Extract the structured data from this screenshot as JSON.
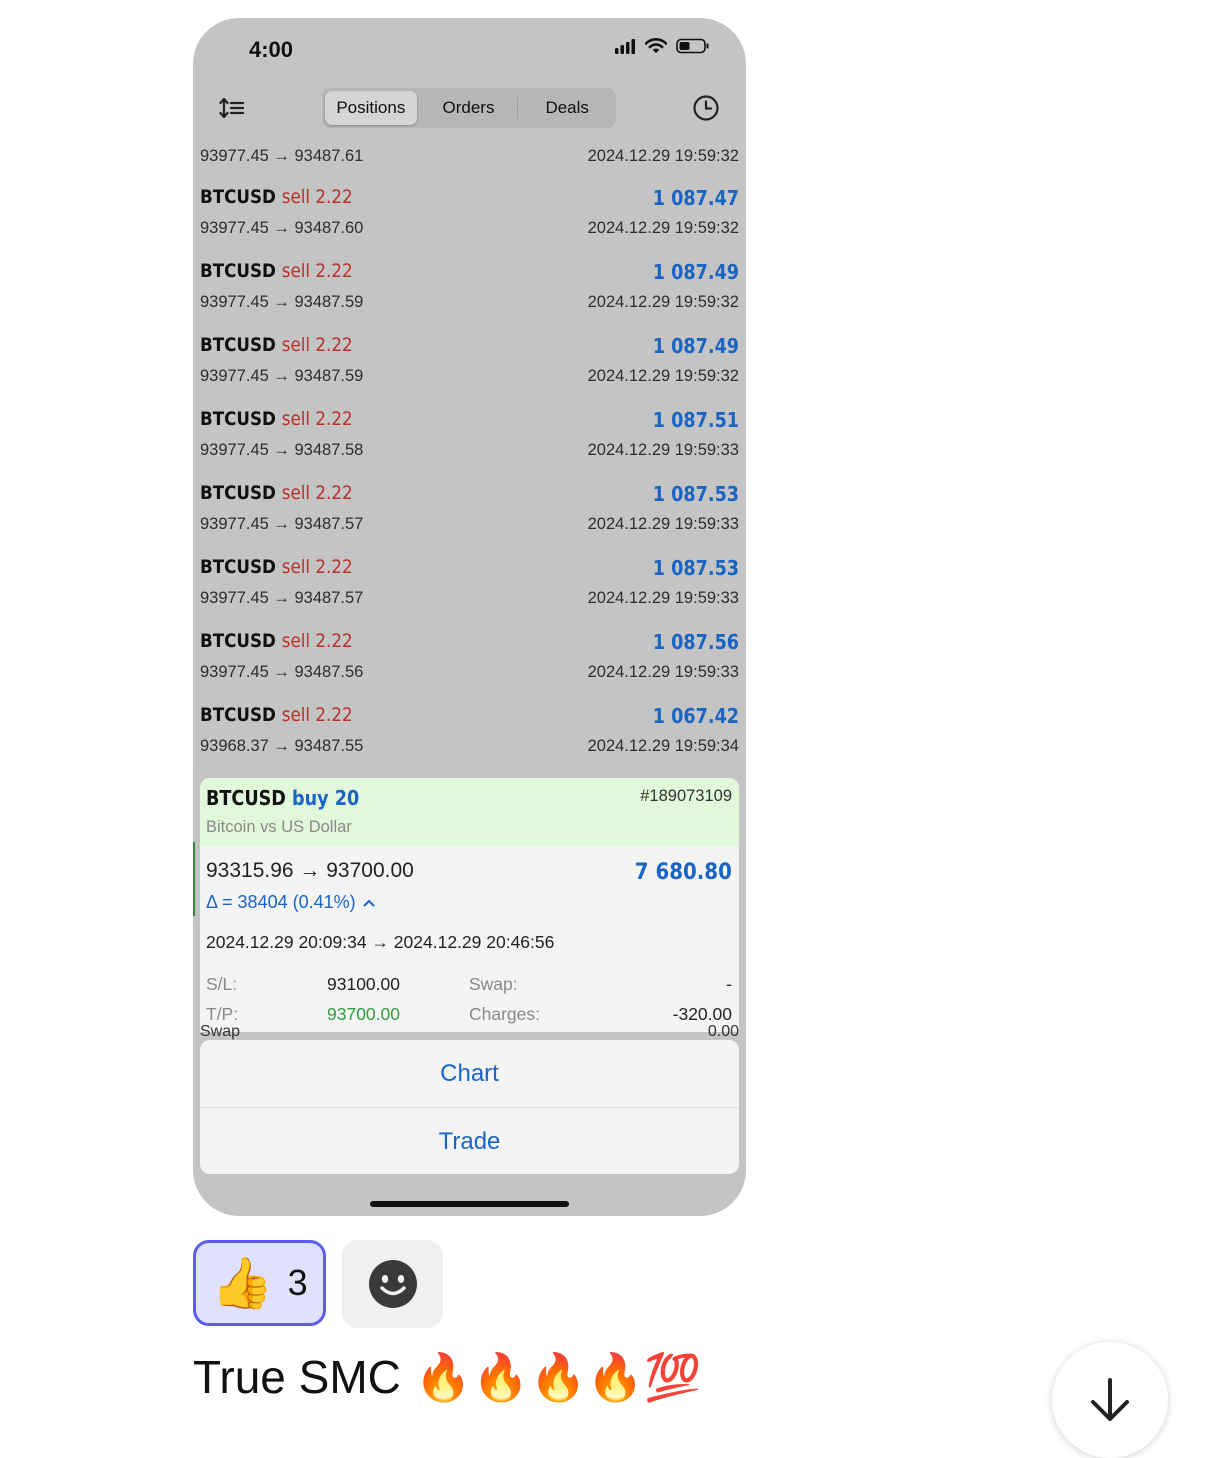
{
  "status_bar": {
    "time": "4:00"
  },
  "tabs": [
    {
      "label": "Positions",
      "active": true
    },
    {
      "label": "Orders",
      "active": false
    },
    {
      "label": "Deals",
      "active": false
    }
  ],
  "first_row_partial": {
    "prices": "93977.45 → 93487.61",
    "time": "2024.12.29 19:59:32"
  },
  "positions": [
    {
      "symbol": "BTCUSD",
      "side": "sell 2.22",
      "profit": "1 087.47",
      "prices": "93977.45 → 93487.60",
      "time": "2024.12.29 19:59:32"
    },
    {
      "symbol": "BTCUSD",
      "side": "sell 2.22",
      "profit": "1 087.49",
      "prices": "93977.45 → 93487.59",
      "time": "2024.12.29 19:59:32"
    },
    {
      "symbol": "BTCUSD",
      "side": "sell 2.22",
      "profit": "1 087.49",
      "prices": "93977.45 → 93487.59",
      "time": "2024.12.29 19:59:32"
    },
    {
      "symbol": "BTCUSD",
      "side": "sell 2.22",
      "profit": "1 087.51",
      "prices": "93977.45 → 93487.58",
      "time": "2024.12.29 19:59:33"
    },
    {
      "symbol": "BTCUSD",
      "side": "sell 2.22",
      "profit": "1 087.53",
      "prices": "93977.45 → 93487.57",
      "time": "2024.12.29 19:59:33"
    },
    {
      "symbol": "BTCUSD",
      "side": "sell 2.22",
      "profit": "1 087.53",
      "prices": "93977.45 → 93487.57",
      "time": "2024.12.29 19:59:33"
    },
    {
      "symbol": "BTCUSD",
      "side": "sell 2.22",
      "profit": "1 087.56",
      "prices": "93977.45 → 93487.56",
      "time": "2024.12.29 19:59:33"
    },
    {
      "symbol": "BTCUSD",
      "side": "sell 2.22",
      "profit": "1 067.42",
      "prices": "93968.37 → 93487.55",
      "time": "2024.12.29 19:59:34"
    }
  ],
  "detail": {
    "symbol": "BTCUSD",
    "side": "buy 20",
    "description": "Bitcoin vs US Dollar",
    "ticket": "#189073109",
    "prices": "93315.96 → 93700.00",
    "profit": "7 680.80",
    "delta": "Δ = 38404 (0.41%)",
    "times": "2024.12.29 20:09:34 → 2024.12.29 20:46:56",
    "sl_label": "S/L:",
    "sl_value": "93100.00",
    "tp_label": "T/P:",
    "tp_value": "93700.00",
    "swap_label": "Swap:",
    "swap_value": "-",
    "charges_label": "Charges:",
    "charges_value": "-320.00",
    "peek_left": "Swap",
    "peek_right": "0.00"
  },
  "actions": {
    "chart": "Chart",
    "trade": "Trade"
  },
  "reactions": {
    "like_emoji": "👍",
    "like_count": "3"
  },
  "message": {
    "text": "True SMC",
    "emojis": "🔥🔥🔥🔥💯"
  },
  "colors": {
    "profit_blue": "#1a64c4",
    "sell_red": "#b8302a",
    "highlight_green": "#e1f8da",
    "reaction_border": "#5b5cf0"
  }
}
